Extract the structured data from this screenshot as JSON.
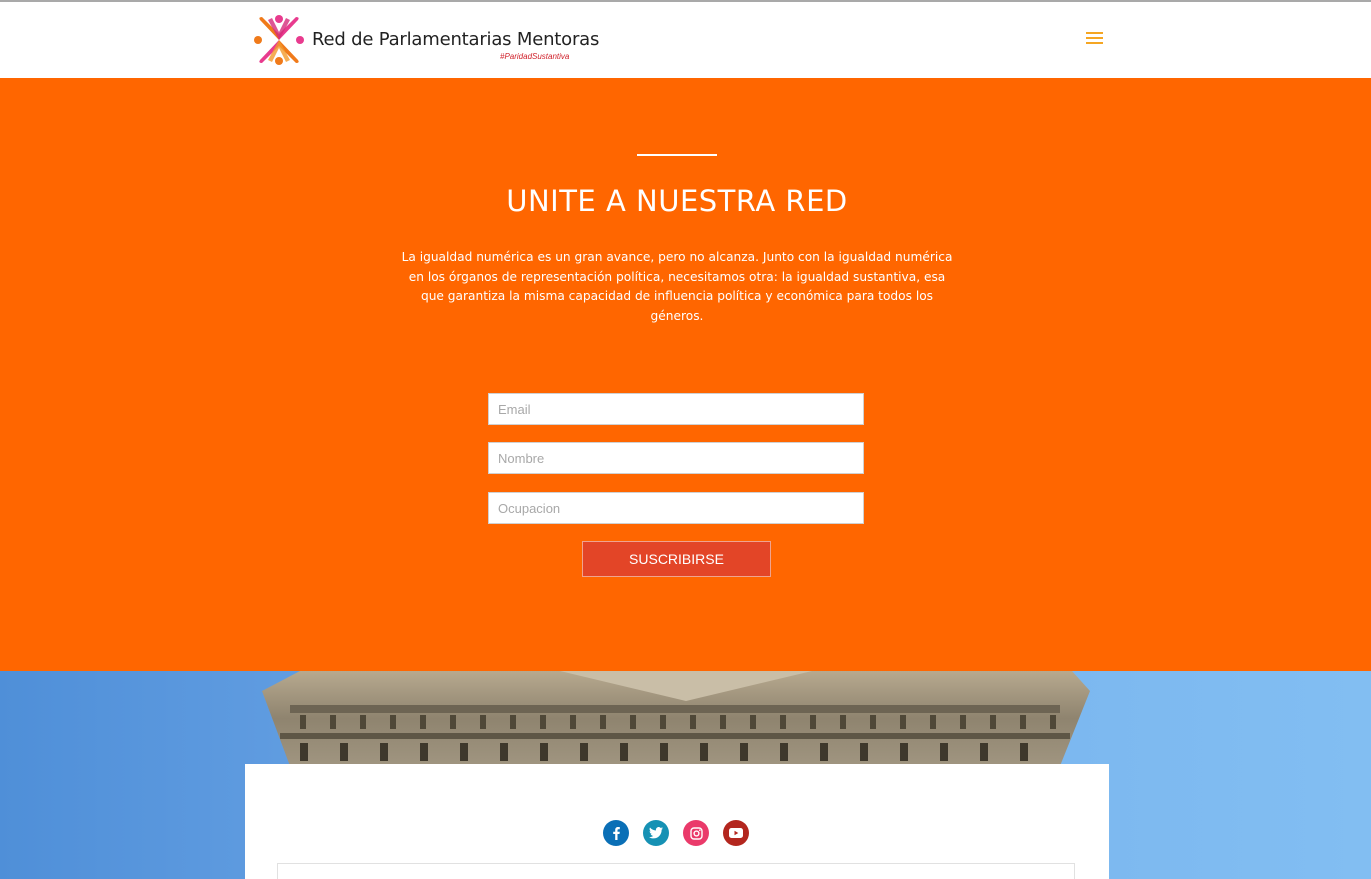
{
  "header": {
    "site_title": "Red de Parlamentarias Mentoras",
    "tagline": "#ParidadSustantiva",
    "menu_icon": "hamburger-menu-icon",
    "menu_color": "#f5a623"
  },
  "hero": {
    "background": "#ff6600",
    "title": "UNITE A NUESTRA RED",
    "text": "La igualdad numérica es un gran avance, pero no alcanza. Junto con la igualdad numérica en los órganos de representación política, necesitamos otra: la igualdad sustantiva, esa que garantiza la misma capacidad de influencia política y económica para todos los géneros."
  },
  "form": {
    "email_placeholder": "Email",
    "name_placeholder": "Nombre",
    "occupation_placeholder": "Ocupacion",
    "submit_label": "SUSCRIBIRSE",
    "submit_color": "#e34527"
  },
  "social": [
    {
      "name": "facebook-icon",
      "color": "#0a6fb6"
    },
    {
      "name": "twitter-icon",
      "color": "#1691b4"
    },
    {
      "name": "instagram-icon",
      "color": "#ea3a6a"
    },
    {
      "name": "youtube-icon",
      "color": "#b3261e"
    }
  ]
}
